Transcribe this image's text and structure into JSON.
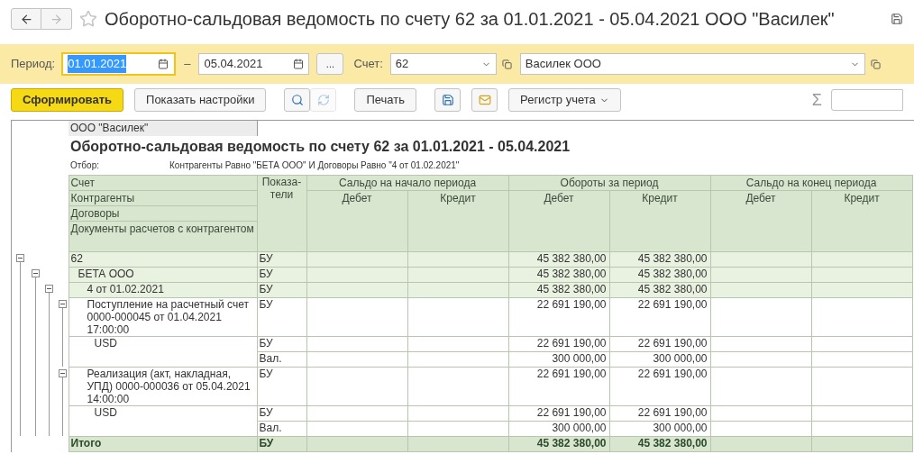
{
  "window": {
    "title": "Оборотно-сальдовая ведомость по счету 62 за 01.01.2021 - 05.04.2021 ООО \"Василек\"",
    "back_disabled": false,
    "forward_disabled": true
  },
  "filters": {
    "period_label": "Период:",
    "date_from": "01.01.2021",
    "date_from_focused": true,
    "dash": "–",
    "date_to": "05.04.2021",
    "more_button": "...",
    "account_label": "Счет:",
    "account": "62",
    "organization": "Василек ООО"
  },
  "toolbar": {
    "buttons": [
      {
        "kind": "primary",
        "label": "Сформировать",
        "disabled": false
      },
      {
        "kind": "text",
        "label": "Показать настройки",
        "disabled": false
      },
      {
        "kind": "search",
        "disabled": false
      },
      {
        "kind": "search-refresh",
        "disabled": true
      },
      {
        "kind": "text",
        "label": "Печать",
        "disabled": false
      },
      {
        "kind": "save",
        "disabled": false
      },
      {
        "kind": "email",
        "disabled": false
      },
      {
        "kind": "dropdown",
        "label": "Регистр учета",
        "disabled": false
      }
    ],
    "sum_symbol": "Σ"
  },
  "report": {
    "organization": "ООО \"Василек\"",
    "title": "Оборотно-сальдовая ведомость по счету 62 за 01.01.2021 - 05.04.2021",
    "filter_label": "Отбор:",
    "filter": "Контрагенты Равно \"БЕТА ООО\" И Договоры Равно \"4 от 01.02.2021\"",
    "header": {
      "row_labels": [
        "Счет",
        "Контрагенты",
        "Договоры",
        "Документы расчетов с контрагентом"
      ],
      "indicators": "Показа-тели",
      "groups": [
        {
          "label": "Сальдо на начало периода",
          "columns": [
            "Дебет",
            "Кредит"
          ]
        },
        {
          "label": "Обороты за период",
          "columns": [
            "Дебет",
            "Кредит"
          ]
        },
        {
          "label": "Сальдо на конец периода",
          "columns": [
            "Дебет",
            "Кредит"
          ]
        }
      ]
    },
    "rows": [
      {
        "kind": "group",
        "label": "62",
        "expanded": true,
        "lines": [
          {
            "indicator": "БУ",
            "values": {
              "turnover_debit": "45 382 380,00",
              "turnover_credit": "45 382 380,00"
            }
          }
        ],
        "children": [
          {
            "kind": "group",
            "label": "БЕТА ООО",
            "expanded": true,
            "lines": [
              {
                "indicator": "БУ",
                "values": {
                  "turnover_debit": "45 382 380,00",
                  "turnover_credit": "45 382 380,00"
                }
              }
            ],
            "children": [
              {
                "kind": "group",
                "label": "4 от 01.02.2021",
                "expanded": true,
                "lines": [
                  {
                    "indicator": "БУ",
                    "values": {
                      "turnover_debit": "45 382 380,00",
                      "turnover_credit": "45 382 380,00"
                    }
                  }
                ],
                "children": [
                  {
                    "kind": "document",
                    "label": "Поступление на расчетный счет 0000-000045 от 01.04.2021 17:00:00",
                    "expanded": true,
                    "lines": [
                      {
                        "indicator": "БУ",
                        "values": {
                          "turnover_debit": "22 691 190,00",
                          "turnover_credit": "22 691 190,00"
                        }
                      }
                    ],
                    "children": [
                      {
                        "kind": "currency",
                        "label": "USD",
                        "lines": [
                          {
                            "indicator": "БУ",
                            "values": {
                              "turnover_debit": "22 691 190,00",
                              "turnover_credit": "22 691 190,00"
                            }
                          },
                          {
                            "indicator": "Вал.",
                            "values": {
                              "turnover_debit": "300 000,00",
                              "turnover_credit": "300 000,00"
                            }
                          }
                        ]
                      }
                    ]
                  },
                  {
                    "kind": "document",
                    "label": "Реализация (акт, накладная, УПД) 0000-000036 от 05.04.2021 14:00:00",
                    "expanded": true,
                    "lines": [
                      {
                        "indicator": "БУ",
                        "values": {
                          "turnover_debit": "22 691 190,00",
                          "turnover_credit": "22 691 190,00"
                        }
                      }
                    ],
                    "children": [
                      {
                        "kind": "currency",
                        "label": "USD",
                        "lines": [
                          {
                            "indicator": "БУ",
                            "values": {
                              "turnover_debit": "22 691 190,00",
                              "turnover_credit": "22 691 190,00"
                            }
                          },
                          {
                            "indicator": "Вал.",
                            "values": {
                              "turnover_debit": "300 000,00",
                              "turnover_credit": "300 000,00"
                            }
                          }
                        ]
                      }
                    ]
                  }
                ]
              }
            ]
          }
        ]
      }
    ],
    "total": {
      "label": "Итого",
      "indicator": "БУ",
      "values": {
        "turnover_debit": "45 382 380,00",
        "turnover_credit": "45 382 380,00"
      }
    }
  }
}
